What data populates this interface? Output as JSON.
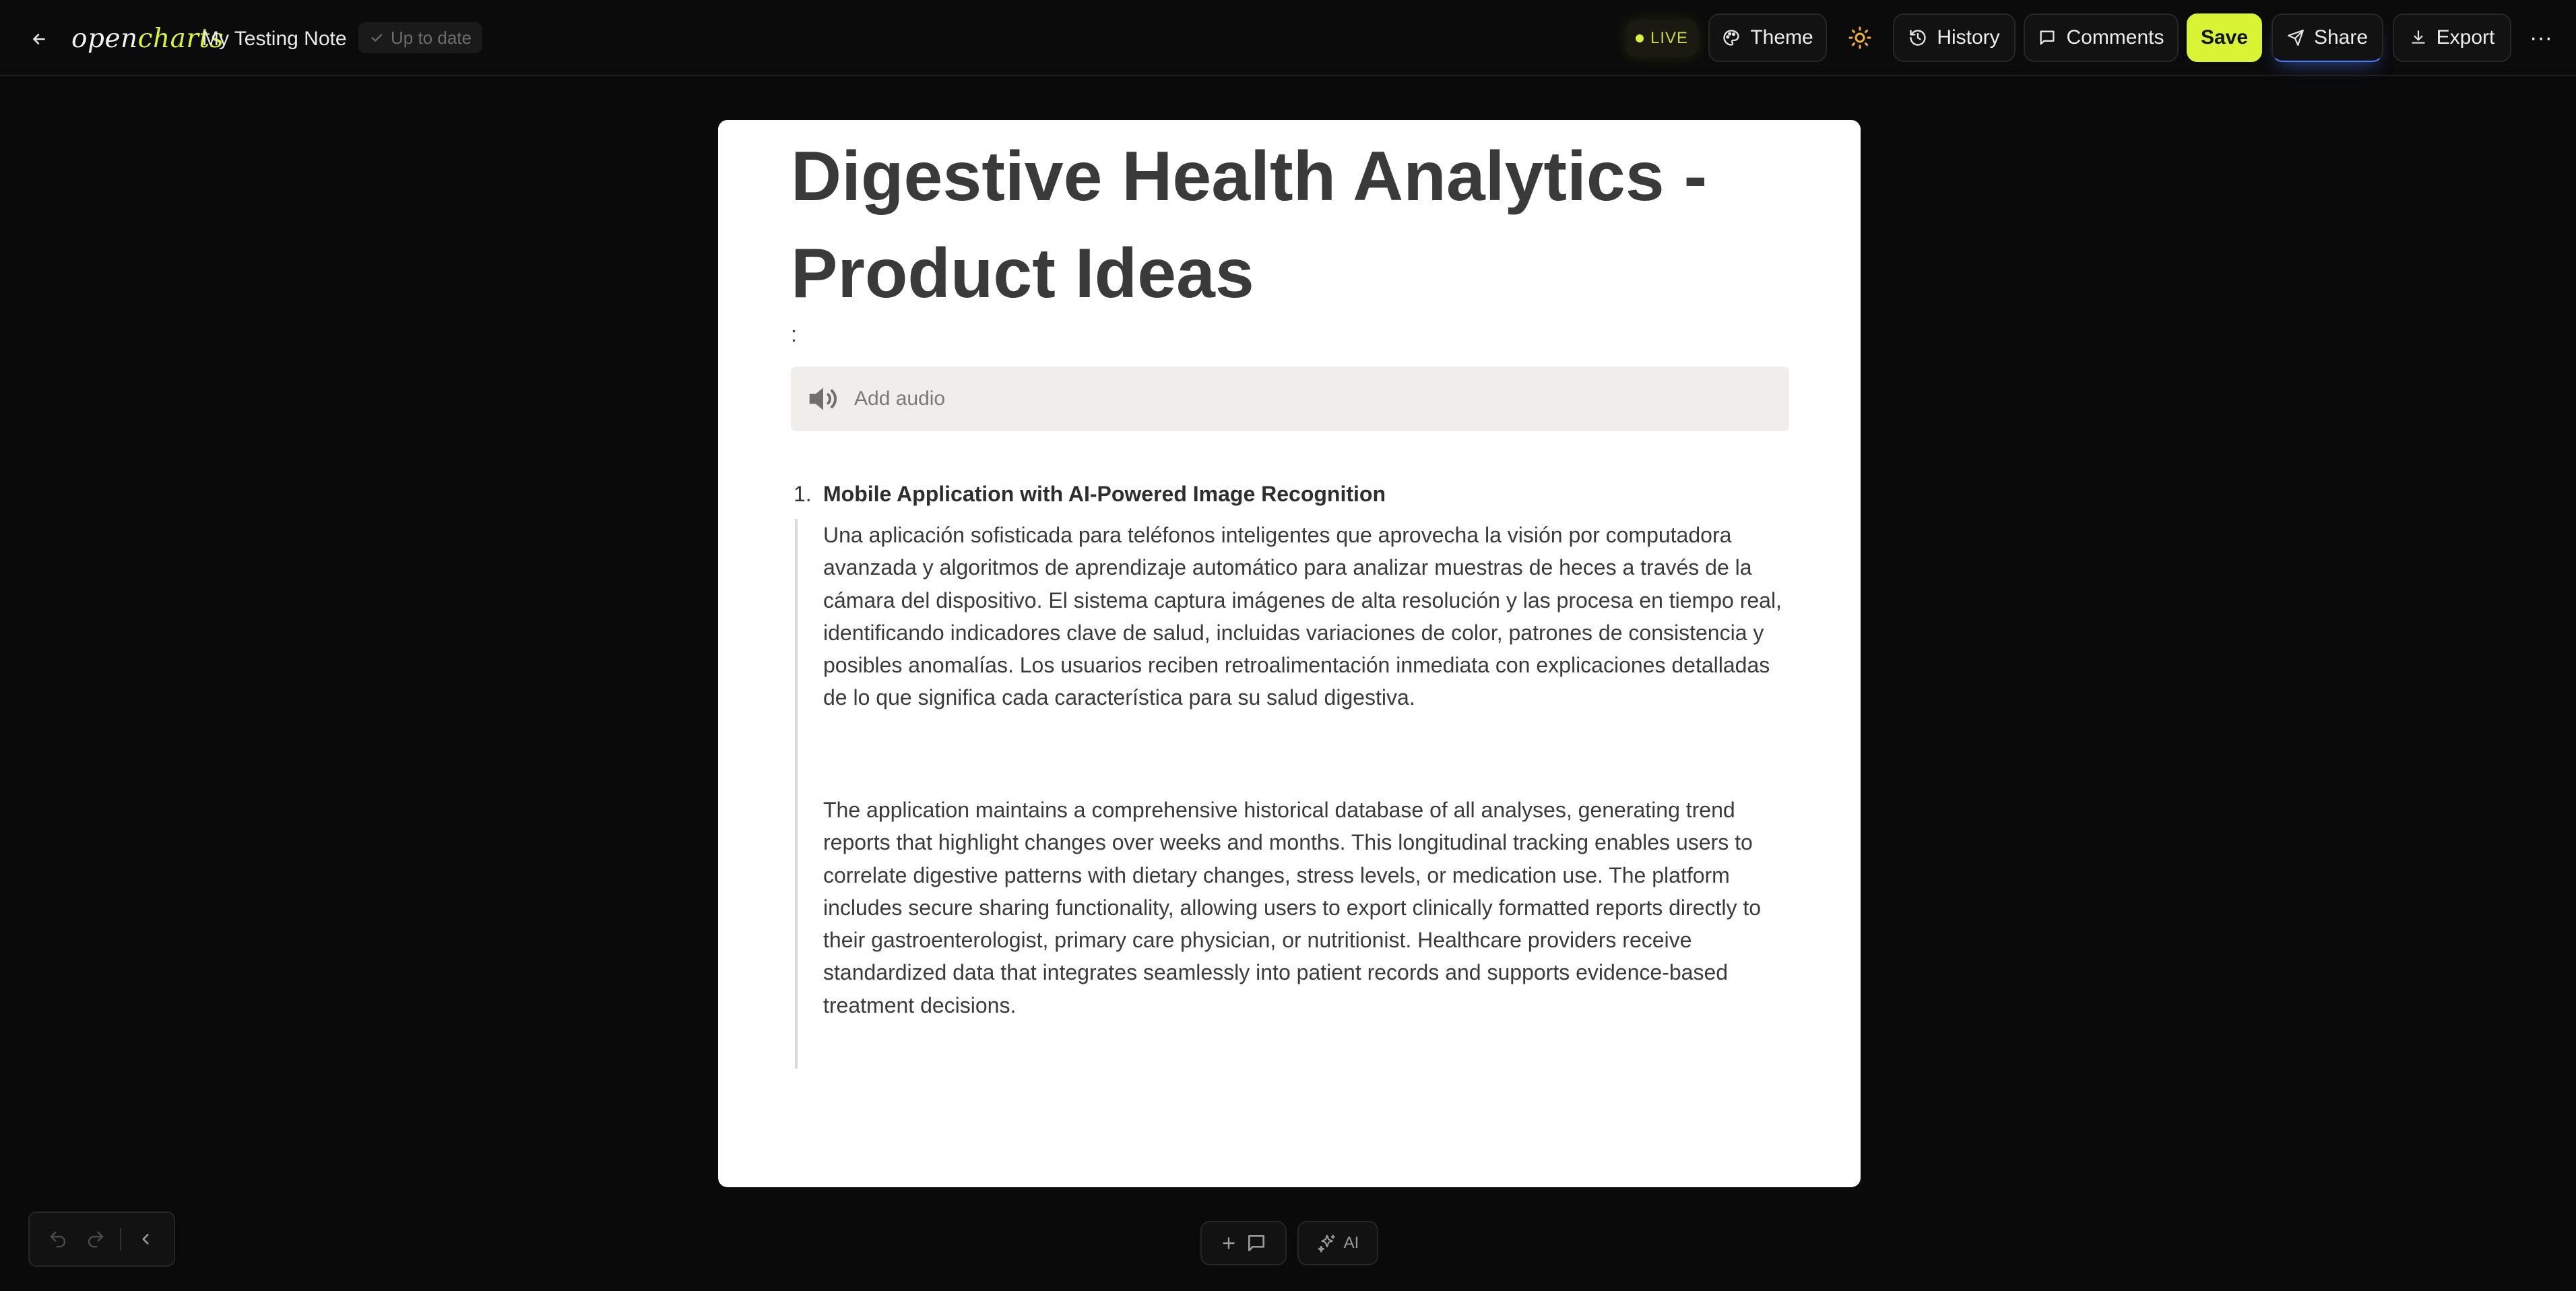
{
  "topbar": {
    "back_icon": "arrow-left-icon",
    "logo": {
      "part1": "open",
      "part2": "charts"
    },
    "document_title": "My Testing Note",
    "status": "Up to date",
    "live_label": "LIVE",
    "buttons": {
      "theme": "Theme",
      "history": "History",
      "comments": "Comments",
      "save": "Save",
      "share": "Share",
      "export": "Export",
      "more": "···"
    }
  },
  "document": {
    "title": "Digestive Health Analytics - Product Ideas",
    "colon": ":",
    "audio_label": "Add audio",
    "list": [
      {
        "number": "1.",
        "title": "Mobile Application with AI-Powered Image Recognition",
        "paragraphs": [
          "Una aplicación sofisticada para teléfonos inteligentes que aprovecha la visión por computadora avanzada y algoritmos de aprendizaje automático para analizar muestras de heces a través de la cámara del dispositivo. El sistema captura imágenes de alta resolución y las procesa en tiempo real, identificando indicadores clave de salud, incluidas variaciones de color, patrones de consistencia y posibles anomalías. Los usuarios reciben retroalimentación inmediata con explicaciones detalladas de lo que significa cada característica para su salud digestiva.",
          "The application maintains a comprehensive historical database of all analyses, generating trend reports that highlight changes over weeks and months. This longitudinal tracking enables users to correlate digestive patterns with dietary changes, stress levels, or medication use. The platform includes secure sharing functionality, allowing users to export clinically formatted reports directly to their gastroenterologist, primary care physician, or nutritionist. Healthcare providers receive standardized data that integrates seamlessly into patient records and supports evidence-based treatment decisions."
        ]
      }
    ]
  },
  "bottom": {
    "ai_label": "AI"
  },
  "colors": {
    "accent": "#d8f432",
    "background": "#0a0a0a",
    "page": "#ffffff",
    "share_glow": "#4d7cff"
  }
}
